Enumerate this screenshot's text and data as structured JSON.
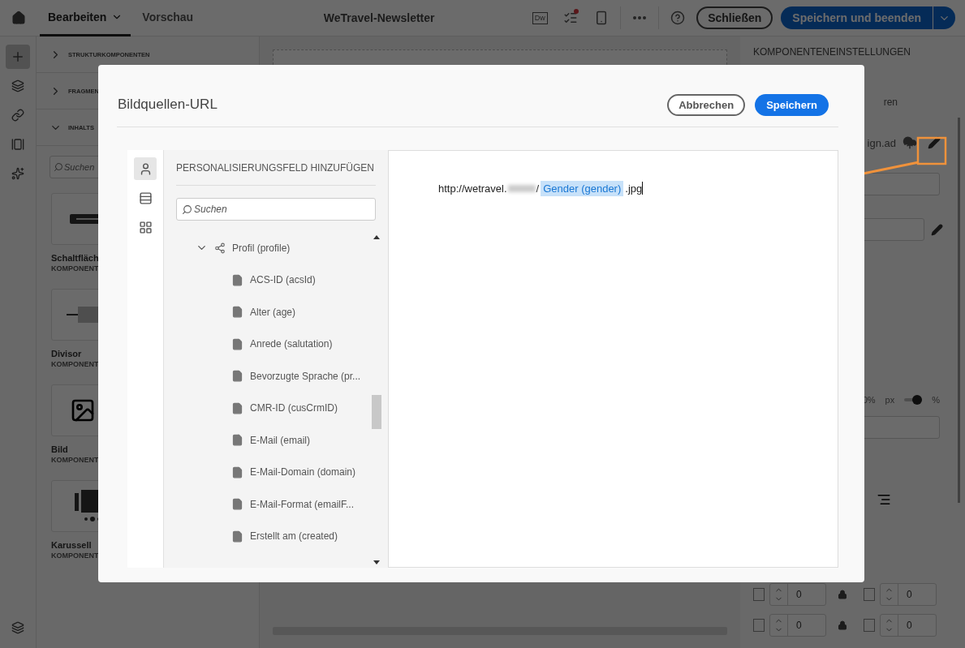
{
  "topbar": {
    "tabs": [
      {
        "label": "Bearbeiten",
        "selected": true
      },
      {
        "label": "Vorschau",
        "selected": false
      }
    ],
    "title": "WeTravel-Newsletter",
    "dw_label": "Dw",
    "checklist_alert": true,
    "close_button": "Schließen",
    "save_button": "Speichern und beenden"
  },
  "left_rail": [
    {
      "kind": "add",
      "selected": true
    },
    {
      "kind": "layers",
      "selected": false
    },
    {
      "kind": "link",
      "selected": false
    },
    {
      "kind": "assets",
      "selected": false
    },
    {
      "kind": "sparkle",
      "selected": false
    }
  ],
  "components_panel": {
    "sections": [
      {
        "title": "STRUKTURKOMPONENTEN",
        "expanded": false
      },
      {
        "title": "FRAGMEN",
        "expanded": false
      },
      {
        "title": "INHALTS",
        "expanded": true
      }
    ],
    "search": {
      "placeholder": "Suchen"
    },
    "cards": [
      {
        "kind": "button",
        "name": "Schaltfläch",
        "category": "KOMPONENT"
      },
      {
        "kind": "divider",
        "name": "Divisor",
        "category": "KOMPONENT"
      },
      {
        "kind": "image",
        "name": "Bild",
        "category": "KOMPONENT"
      },
      {
        "kind": "carousel",
        "name": "Karussell",
        "category": "KOMPONENT"
      }
    ]
  },
  "settings_panel": {
    "title": "KOMPONENTENEINSTELLUNGEN",
    "label_fragment": "ren",
    "file_fragment": "ign.ad",
    "width_fragment": "0%",
    "unit_px": "px",
    "unit_pct": "%",
    "percent_on": true,
    "spacing": [
      "0",
      "0",
      "0",
      "0"
    ]
  },
  "dialog": {
    "title": "Bildquellen-URL",
    "cancel": "Abbrechen",
    "save": "Speichern",
    "tabs": [
      {
        "kind": "personalization",
        "selected": true
      },
      {
        "kind": "blocks",
        "selected": false
      },
      {
        "kind": "fragments",
        "selected": false
      }
    ],
    "panel_title": "PERSONALISIERUNGSFELD HINZUFÜGEN",
    "search": {
      "placeholder": "Suchen"
    },
    "tree": [
      {
        "label": "Profil (profile)",
        "kind": "link",
        "expanded": true,
        "children": [
          {
            "label": "ACS-ID (acsId)",
            "kind": "field"
          },
          {
            "label": "Alter (age)",
            "kind": "field"
          },
          {
            "label": "Anrede (salutation)",
            "kind": "field"
          },
          {
            "label": "Bevorzugte Sprache (pr...",
            "kind": "field"
          },
          {
            "label": "CMR-ID (cusCrmID)",
            "kind": "field"
          },
          {
            "label": "E-Mail (email)",
            "kind": "field"
          },
          {
            "label": "E-Mail-Domain (domain)",
            "kind": "field"
          },
          {
            "label": "E-Mail-Format (emailF...",
            "kind": "field"
          },
          {
            "label": "Erstellt am (created)",
            "kind": "field"
          }
        ]
      }
    ],
    "editor": {
      "prefix": "http://wetravel.",
      "separator": "/",
      "token": "Gender (gender)",
      "suffix": ".jpg"
    }
  }
}
